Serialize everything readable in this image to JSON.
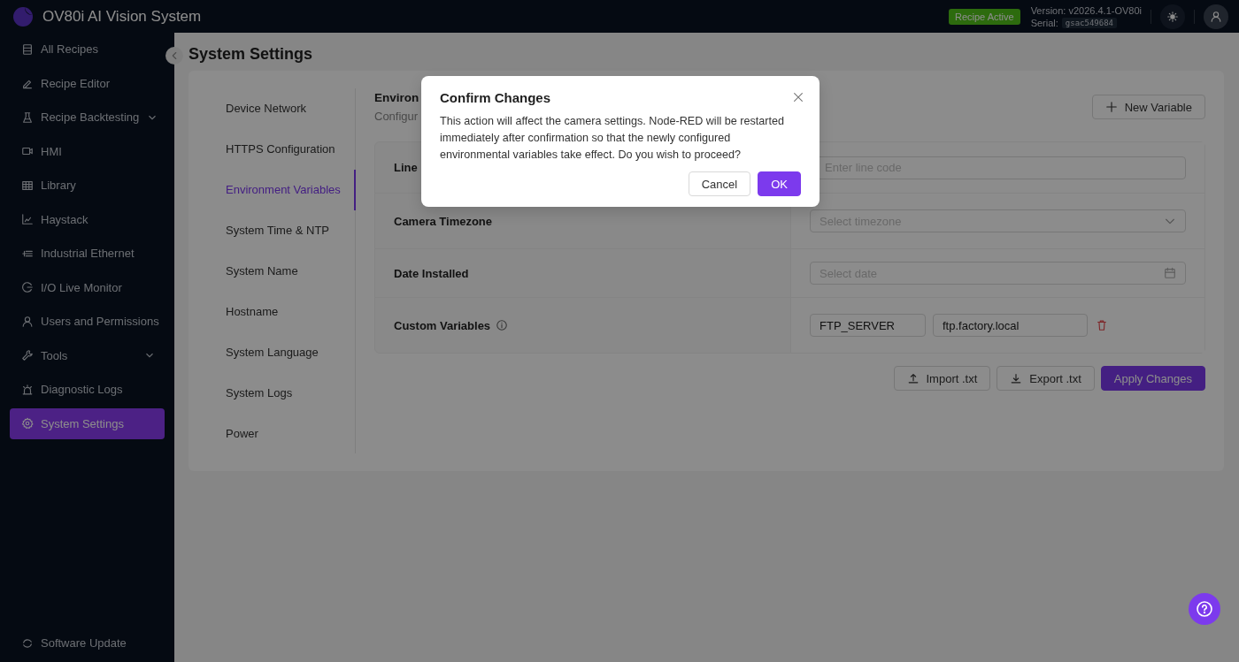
{
  "app": {
    "title": "OV80i AI Vision System",
    "status_badge": "Recipe Active",
    "version": "Version: v2026.4.1-OV80i",
    "serial_label": "Serial:",
    "serial": "gsac549684"
  },
  "sidebar": {
    "items": [
      {
        "label": "All Recipes",
        "expandable": false,
        "selected": false
      },
      {
        "label": "Recipe Editor",
        "expandable": false,
        "selected": false
      },
      {
        "label": "Recipe Backtesting",
        "expandable": true,
        "selected": false
      },
      {
        "label": "HMI",
        "expandable": false,
        "selected": false
      },
      {
        "label": "Library",
        "expandable": false,
        "selected": false
      },
      {
        "label": "Haystack",
        "expandable": false,
        "selected": false
      },
      {
        "label": "Industrial Ethernet",
        "expandable": false,
        "selected": false
      },
      {
        "label": "I/O Live Monitor",
        "expandable": false,
        "selected": false
      },
      {
        "label": "Users and Permissions",
        "expandable": false,
        "selected": false
      },
      {
        "label": "Tools",
        "expandable": true,
        "selected": false
      },
      {
        "label": "Diagnostic Logs",
        "expandable": false,
        "selected": false
      },
      {
        "label": "System Settings",
        "expandable": false,
        "selected": true
      }
    ],
    "footer": "Software Update"
  },
  "page_title": "System Settings",
  "settings_nav": [
    {
      "label": "Device Network",
      "selected": false
    },
    {
      "label": "HTTPS Configuration",
      "selected": false
    },
    {
      "label": "Environment Variables",
      "selected": true
    },
    {
      "label": "System Time & NTP",
      "selected": false
    },
    {
      "label": "System Name",
      "selected": false
    },
    {
      "label": "Hostname",
      "selected": false
    },
    {
      "label": "System Language",
      "selected": false
    },
    {
      "label": "System Logs",
      "selected": false
    },
    {
      "label": "Power",
      "selected": false
    }
  ],
  "section": {
    "heading": "Environ",
    "subtitle": "Configur",
    "new_button": "New Variable"
  },
  "rows": [
    {
      "kind": "input",
      "label": "Line",
      "placeholder": "Enter line code"
    },
    {
      "kind": "select",
      "label": "Camera Timezone",
      "placeholder": "Select timezone"
    },
    {
      "kind": "date",
      "label": "Date Installed",
      "placeholder": "Select date"
    },
    {
      "kind": "custom",
      "label": "Custom Variables",
      "key": "FTP_SERVER",
      "value": "ftp.factory.local"
    }
  ],
  "actions": [
    {
      "kind": "import",
      "label": "Import .txt"
    },
    {
      "kind": "export",
      "label": "Export .txt"
    },
    {
      "kind": "primary",
      "label": "Apply Changes"
    }
  ],
  "dialog": {
    "title": "Confirm Changes",
    "body": "This action will affect the camera settings. Node-RED will be restarted immediately after confirmation so that the newly configured environmental variables take effect. Do you wish to proceed?",
    "cancel": "Cancel",
    "ok": "OK"
  }
}
